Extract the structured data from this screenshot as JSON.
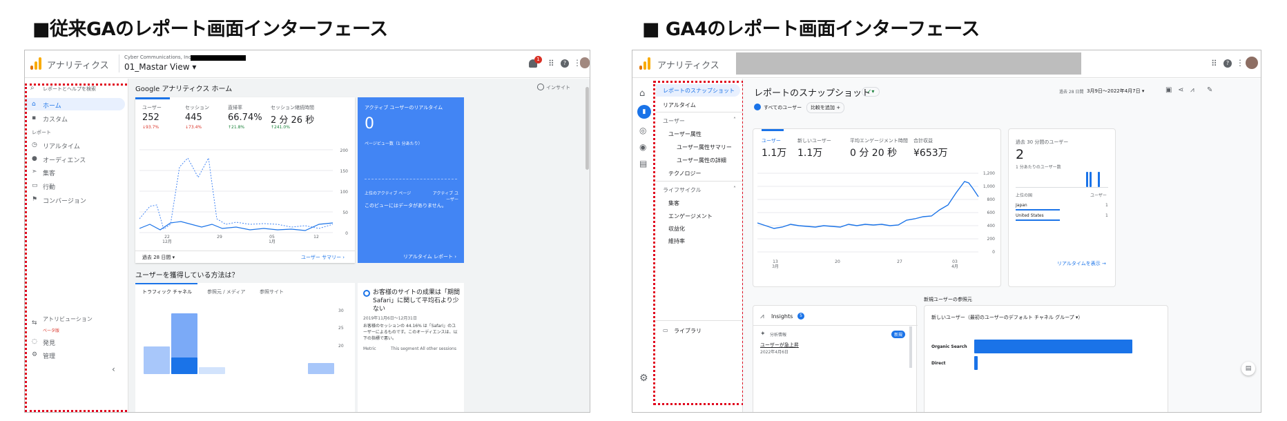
{
  "headings": {
    "left": "■従来GAのレポート画面インターフェース",
    "right": "■ GA4のレポート画面インターフェース"
  },
  "ua": {
    "app_name": "アナリティクス",
    "account": "Cyber Communications, Inc >",
    "view": "01_Mastar View ▾",
    "notif_count": "1",
    "search_placeholder": "レポートとヘルプを検索",
    "nav": {
      "home": "ホーム",
      "custom": "カスタム",
      "reports_label": "レポート",
      "realtime": "リアルタイム",
      "audience": "オーディエンス",
      "acquisition": "集客",
      "behavior": "行動",
      "conversions": "コンバージョン",
      "attribution": "アトリビューション",
      "attribution_beta": "ベータ版",
      "discover": "発見",
      "admin": "管理",
      "collapse": "‹"
    },
    "home_title": "Google アナリティクス ホーム",
    "insight_label": "インサイト",
    "metrics": [
      {
        "label": "ユーザー",
        "value": "252",
        "delta": "↓93.7%"
      },
      {
        "label": "セッション",
        "value": "445",
        "delta": "↓73.4%"
      },
      {
        "label": "直帰率",
        "value": "66.74%",
        "delta": "↑21.8%"
      },
      {
        "label": "セッション継続時間",
        "value": "2 分 26 秒",
        "delta": "↑241.0%"
      }
    ],
    "y_ticks": [
      "200",
      "150",
      "100",
      "50",
      "0"
    ],
    "x_ticks": [
      "22\n12月",
      "29",
      "05\n1月",
      "12"
    ],
    "date_range": "過去 28 日間 ▾",
    "user_summary_link": "ユーザー サマリー ›",
    "realtime_card": {
      "title": "アクティブ ユーザーのリアルタイム",
      "value": "0",
      "sub": "ページビュー数（1 分あたり）",
      "col1": "上位のアクティブ ページ",
      "col2": "アクティブ ユーザー",
      "empty": "このビューにはデータがありません。",
      "link": "リアルタイム レポート ›"
    },
    "acq_title": "ユーザーを獲得している方法は？",
    "acq_tabs": [
      "トラフィック チャネル",
      "参照元 / メディア",
      "参照サイト"
    ],
    "acq_ticks": [
      "30",
      "25",
      "20"
    ],
    "insight_card": {
      "title": "お客様のサイトの成果は「期間 Safari」に関して平均石より少ない",
      "date": "2019年11月6日～12月31日",
      "body": "お客様のセッションの 44.16% は「Safari」のユーザーによるものです。このオーディエンスは、以下の指標で悪い。",
      "foot1": "Metric",
      "foot2": "This segment All other sessions"
    }
  },
  "ga4": {
    "app_name": "アナリティクス",
    "nav": {
      "snapshot": "レポートのスナップショット",
      "realtime": "リアルタイム",
      "user": "ユーザー",
      "user_attr": "ユーザー属性",
      "user_attr_summary": "ユーザー属性サマリー",
      "user_attr_detail": "ユーザー属性の詳細",
      "technology": "テクノロジー",
      "lifecycle": "ライフサイクル",
      "acquisition": "集客",
      "engagement": "エンゲージメント",
      "monetization": "収益化",
      "retention": "維持率",
      "library": "ライブラリ"
    },
    "title": "レポートのスナップショット",
    "date_prefix": "過去 28 日間",
    "date_range": "3月9日～2022年4月7日 ▾",
    "all_users": "すべてのユーザー",
    "add_compare": "比較を追加 +",
    "metrics": [
      {
        "label": "ユーザー",
        "value": "1.1万"
      },
      {
        "label": "新しいユーザー",
        "value": "1.1万"
      },
      {
        "label": "平均エンゲージメント時間",
        "value": "0 分 20 秒"
      },
      {
        "label": "合計収益",
        "value": "¥653万"
      }
    ],
    "y_ticks": [
      "1,200",
      "1,000",
      "800",
      "600",
      "400",
      "200",
      "0"
    ],
    "x_ticks": [
      "13\n3月",
      "20",
      "27",
      "03\n4月"
    ],
    "rt_card": {
      "title": "過去 30 分間のユーザー",
      "value": "2",
      "sub": "1 分あたりのユーザー数",
      "col1": "上位の国",
      "col2": "ユーザー",
      "rows": [
        {
          "country": "Japan",
          "users": "1"
        },
        {
          "country": "United States",
          "users": "1"
        }
      ],
      "link": "リアルタイムを表示 →"
    },
    "new_user_source": "新規ユーザーの参照元",
    "insights": {
      "title": "Insights",
      "count": "5",
      "item_tag": "分析情報",
      "new_badge": "新規",
      "item_text": "ユーザーが急上昇",
      "item_date": "2022年4月6日"
    },
    "channel_card": {
      "title": "新しいユーザー（最初のユーザーのデフォルト チャネル グループ ▾）",
      "rows": [
        {
          "label": "Organic Search",
          "value": 0.88
        },
        {
          "label": "Direct",
          "value": 0.02
        }
      ]
    }
  }
}
